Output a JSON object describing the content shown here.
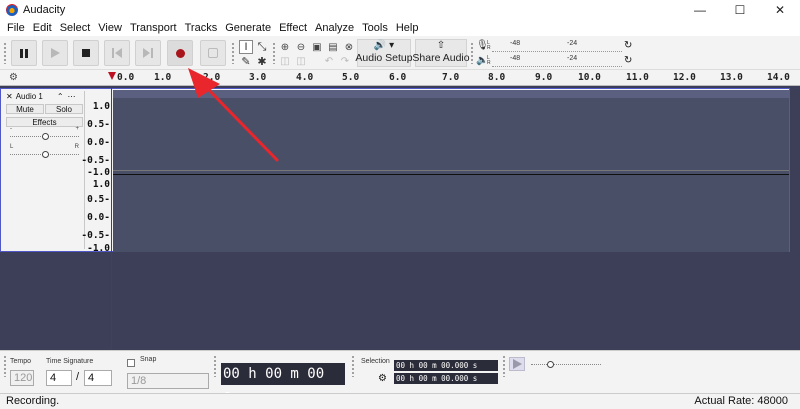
{
  "window": {
    "title": "Audacity"
  },
  "menu": [
    "File",
    "Edit",
    "Select",
    "View",
    "Transport",
    "Tracks",
    "Generate",
    "Effect",
    "Analyze",
    "Tools",
    "Help"
  ],
  "toolbar": {
    "audio_setup_label": "Audio Setup",
    "share_audio_label": "Share Audio"
  },
  "meters": {
    "record": [
      "-48",
      "-24",
      "0"
    ],
    "playback": [
      "-48",
      "-24",
      "0"
    ]
  },
  "ruler": {
    "ticks": [
      "0.0",
      "1.0",
      "2.0",
      "3.0",
      "4.0",
      "5.0",
      "6.0",
      "7.0",
      "8.0",
      "9.0",
      "10.0",
      "11.0",
      "12.0",
      "13.0",
      "14.0"
    ]
  },
  "track": {
    "name": "Audio 1",
    "mute_label": "Mute",
    "solo_label": "Solo",
    "effects_label": "Effects",
    "pan_left": "L",
    "pan_right": "R",
    "gain_minus": "-",
    "gain_plus": "+",
    "amp_labels_top": [
      "1.0",
      "0.5-",
      "0.0-",
      "-0.5-",
      "-1.0"
    ],
    "amp_labels_bottom": [
      "1.0",
      "0.5-",
      "0.0-",
      "-0.5-",
      "-1.0"
    ]
  },
  "bottom": {
    "tempo_label": "Tempo",
    "tempo_value": "120",
    "time_sig_label": "Time Signature",
    "time_sig_num": "4",
    "time_sig_den": "4",
    "snap_label": "Snap",
    "snap_value": "1/8",
    "time_display": "00 h 00 m 00 s",
    "selection_label": "Selection",
    "sel_start": "00 h 00 m 00.000 s",
    "sel_end": "00 h 00 m 00.000 s"
  },
  "status": {
    "left": "Recording.",
    "right": "Actual Rate: 48000"
  },
  "colors": {
    "accent_arrow": "#e8262b",
    "track_bg": "#4a4f68",
    "track_border": "#5058c8"
  }
}
